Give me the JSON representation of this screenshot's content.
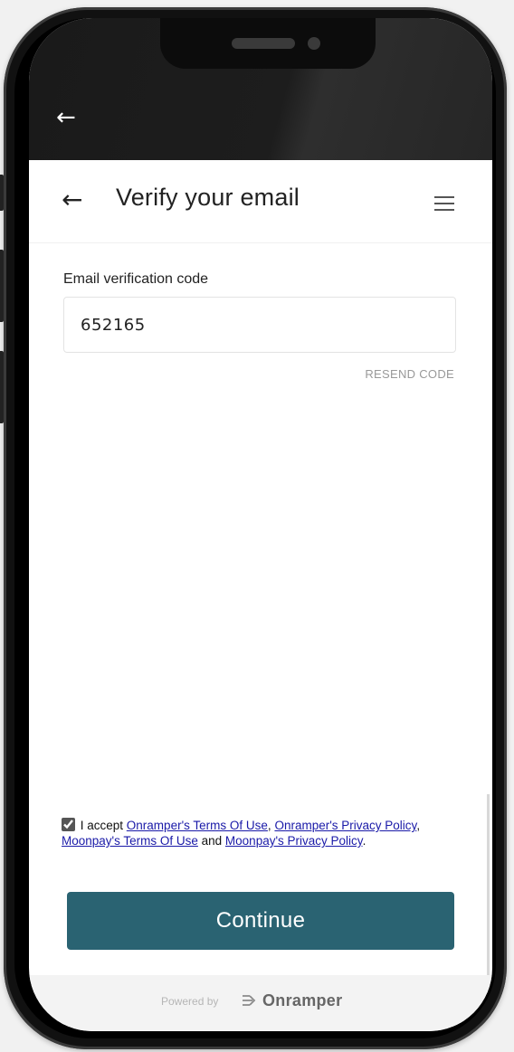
{
  "topbar": {
    "back_icon": "arrow-left-icon"
  },
  "header": {
    "title": "Verify your email",
    "back_icon": "arrow-left-icon",
    "menu_icon": "hamburger-menu-icon"
  },
  "form": {
    "label": "Email verification code",
    "value": "652165",
    "resend_label": "RESEND CODE"
  },
  "terms": {
    "checked": true,
    "prefix": "I accept ",
    "link1": "Onramper's Terms Of Use",
    "sep1": ", ",
    "link2": "Onramper's Privacy Policy",
    "sep2": ", ",
    "link3": "Moonpay's Terms Of Use",
    "sep3": " and ",
    "link4": "Moonpay's Privacy Policy",
    "suffix": "."
  },
  "continue_label": "Continue",
  "footer": {
    "powered": "Powered by",
    "brand": "Onramper"
  },
  "colors": {
    "primary": "#2a6372",
    "link": "#1a1aa8"
  }
}
